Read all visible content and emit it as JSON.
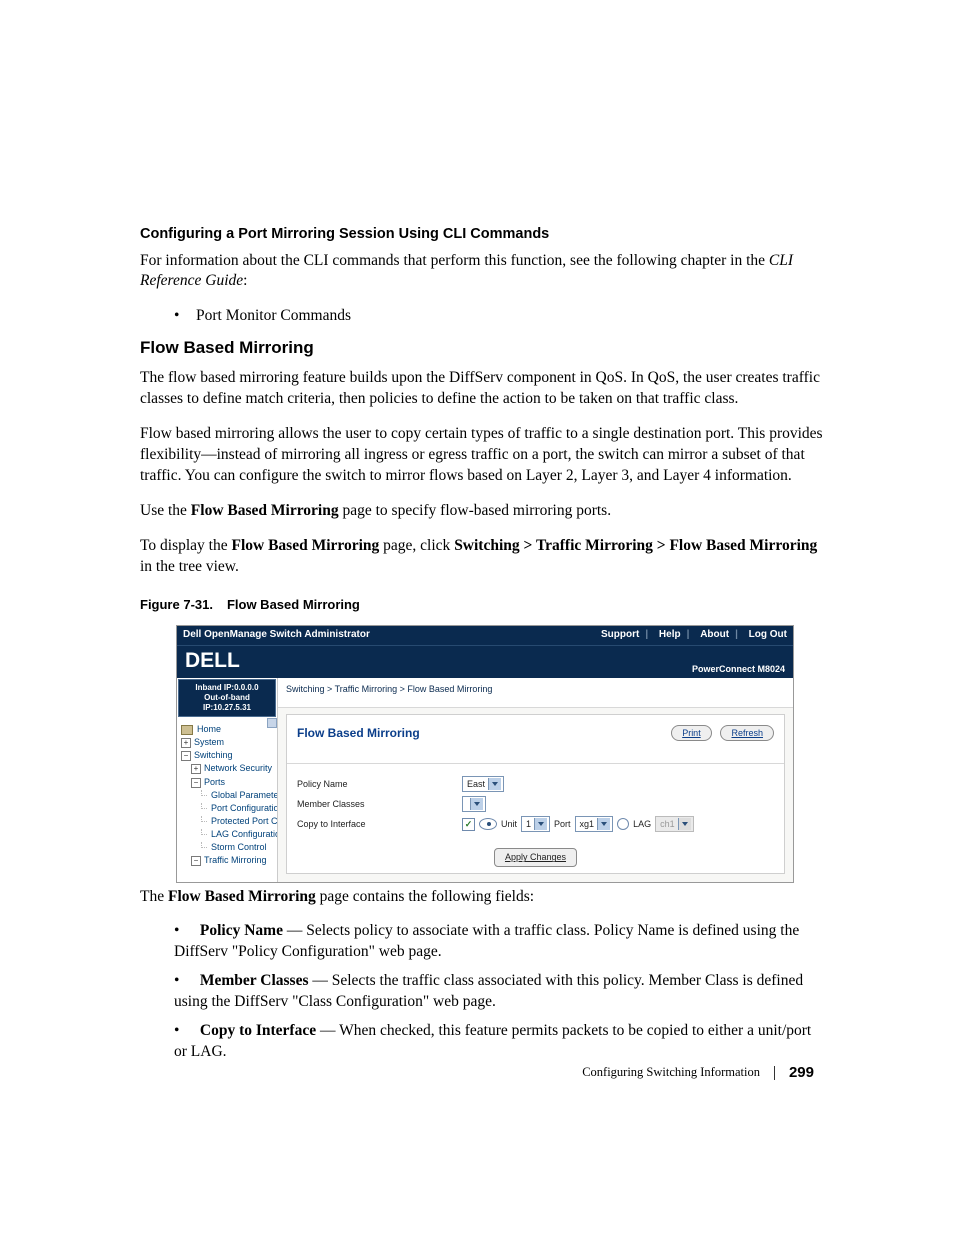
{
  "headings": {
    "cli": "Configuring a Port Mirroring Session Using CLI Commands",
    "flow": "Flow Based Mirroring"
  },
  "text": {
    "cli_intro_a": "For information about the CLI commands that perform this function, see the following chapter in the ",
    "cli_intro_guide": "CLI Reference Guide",
    "cli_intro_b": ":",
    "cli_bullet_1": "Port Monitor Commands",
    "flow_p1": "The flow based mirroring feature builds upon the DiffServ component in QoS. In QoS, the user creates traffic classes to define match criteria, then policies to define the action to be taken on that traffic class.",
    "flow_p2": "Flow based mirroring allows the user to copy certain types of traffic to a single destination port. This provides flexibility—instead of mirroring all ingress or egress traffic on a port, the switch can mirror a subset of that traffic. You can configure the switch to mirror flows based on Layer 2, Layer 3, and Layer 4 information.",
    "flow_p3_a": "Use the ",
    "flow_p3_b": "Flow Based Mirroring",
    "flow_p3_c": " page to specify flow-based mirroring ports.",
    "flow_nav_a": "To display the ",
    "flow_nav_b": "Flow Based Mirroring",
    "flow_nav_c": " page, click ",
    "flow_nav_d": "Switching > Traffic Mirroring > Flow Based Mirroring",
    "flow_nav_e": " in the tree view.",
    "fig_caption_a": "Figure 7-31.",
    "fig_caption_b": "Flow Based Mirroring",
    "fields_intro_a": "The ",
    "fields_intro_b": "Flow Based Mirroring",
    "fields_intro_c": " page contains the following fields:"
  },
  "fields": {
    "policy": {
      "name": "Policy Name",
      "desc": " — Selects policy to associate with a traffic class. Policy Name is defined using the DiffServ \"Policy Configuration\" web page."
    },
    "member": {
      "name": "Member Classes",
      "desc": " — Selects the traffic class associated with this policy. Member Class is defined using the DiffServ \"Class Configuration\" web page."
    },
    "copy": {
      "name": "Copy to Interface",
      "desc": " — When checked, this feature permits packets to be copied to either a unit/port or LAG."
    }
  },
  "ui": {
    "title": "Dell OpenManage Switch Administrator",
    "links": {
      "support": "Support",
      "help": "Help",
      "about": "About",
      "logout": "Log Out"
    },
    "product": "PowerConnect M8024",
    "logo": "DELL",
    "ip1": "Inband IP:0.0.0.0",
    "ip2": "Out-of-band IP:10.27.5.31",
    "tree": {
      "home": "Home",
      "system": "System",
      "switching": "Switching",
      "netsec": "Network Security",
      "ports": "Ports",
      "gparam": "Global Paramete",
      "pconf": "Port Configuratio",
      "pprot": "Protected Port C",
      "lag": "LAG Configuratio",
      "storm": "Storm Control",
      "tmirror": "Traffic Mirroring"
    },
    "breadcrumb": "Switching > Traffic Mirroring > Flow Based Mirroring",
    "panel_title": "Flow Based Mirroring",
    "print": "Print",
    "refresh": "Refresh",
    "form": {
      "policy_label": "Policy Name",
      "policy_value": "East",
      "member_label": "Member Classes",
      "member_value": "",
      "copy_label": "Copy to Interface",
      "unit_label": "Unit",
      "unit_value": "1",
      "port_label": "Port",
      "port_value": "xg1",
      "lag_label": "LAG",
      "lag_value": "ch1"
    },
    "apply": "Apply Changes"
  },
  "footer": {
    "section": "Configuring Switching Information",
    "page": "299"
  }
}
